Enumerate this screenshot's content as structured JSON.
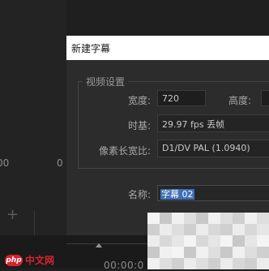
{
  "dialog": {
    "title": "新建字幕",
    "video_settings_legend": "视频设置",
    "width_label": "宽度:",
    "width_value": "720",
    "height_label": "高度:",
    "timebase_label": "时基:",
    "timebase_value": "29.97 fps 丢帧",
    "par_label": "像素长宽比:",
    "par_value": "D1/DV PAL (1.0940)",
    "name_label": "名称:",
    "name_value": "字幕 02"
  },
  "background": {
    "left_number": "00",
    "left_zero": "0",
    "timecode": "00:00:0"
  },
  "watermark": {
    "logo": "php",
    "text": "中文网"
  },
  "colors": {
    "accent_selection": "#3f6fb5",
    "watermark": "#d9232d"
  }
}
